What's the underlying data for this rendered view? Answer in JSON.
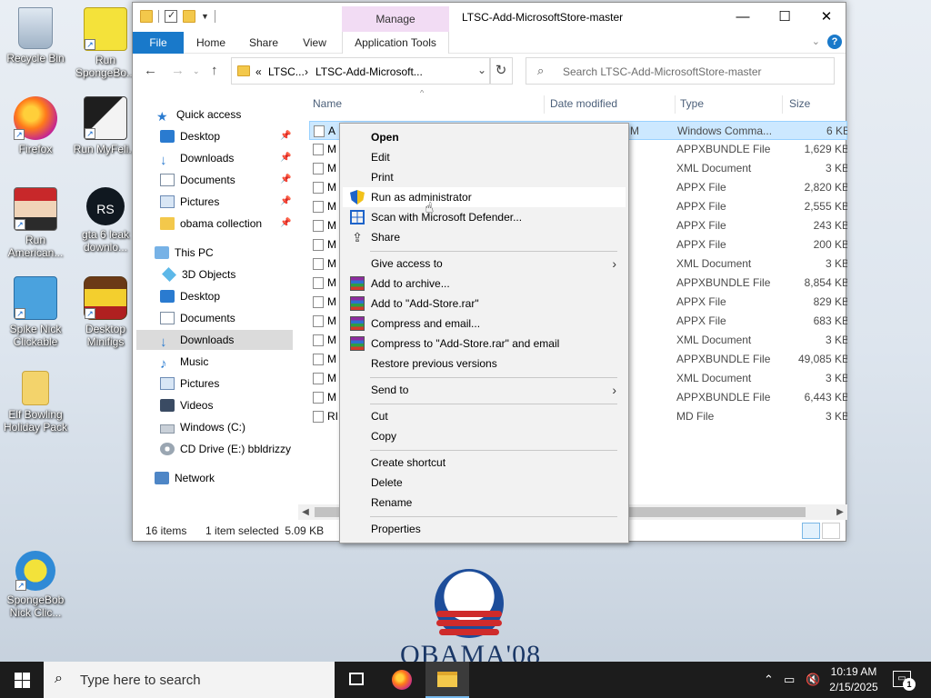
{
  "desktop": {
    "icons": [
      {
        "label": "Recycle Bin"
      },
      {
        "label": "Run SpongeBo..."
      },
      {
        "label": "Firefox"
      },
      {
        "label": "Run MyFeli..."
      },
      {
        "label": "Run American..."
      },
      {
        "label": "gta 6 leak downlo..."
      },
      {
        "label": "Spike Nick Clickable"
      },
      {
        "label": "Desktop Minifigs"
      },
      {
        "label": "Elf Bowling Holiday Pack"
      },
      {
        "label": "SpongeBob Nick Clic..."
      }
    ],
    "wallpaper_text": "OBAMA'08"
  },
  "window": {
    "title": "LTSC-Add-MicrosoftStore-master",
    "manage_header": "Manage",
    "controls": {
      "minimize": "—",
      "maximize": "☐",
      "close": "✕"
    },
    "ribbon_tabs": [
      "File",
      "Home",
      "Share",
      "View",
      "Application Tools"
    ],
    "help": "?",
    "address": {
      "crumbs": [
        "«",
        "LTSC...",
        "›",
        "LTSC-Add-Microsoft...",
        "⌄"
      ]
    },
    "search_placeholder": "Search LTSC-Add-MicrosoftStore-master",
    "nav": [
      {
        "label": "Quick access",
        "icon": "star-icon"
      },
      {
        "label": "Desktop",
        "icon": "desktop-icon",
        "pinned": true
      },
      {
        "label": "Downloads",
        "icon": "download-icon",
        "pinned": true
      },
      {
        "label": "Documents",
        "icon": "documents-icon",
        "pinned": true
      },
      {
        "label": "Pictures",
        "icon": "pictures-icon",
        "pinned": true
      },
      {
        "label": "obama collection",
        "icon": "folder-icon",
        "pinned": true
      },
      {
        "label": "This PC",
        "icon": "computer-icon"
      },
      {
        "label": "3D Objects",
        "icon": "cube-icon"
      },
      {
        "label": "Desktop",
        "icon": "desktop-icon"
      },
      {
        "label": "Documents",
        "icon": "documents-icon"
      },
      {
        "label": "Downloads",
        "icon": "download-icon",
        "selected": true
      },
      {
        "label": "Music",
        "icon": "music-icon"
      },
      {
        "label": "Pictures",
        "icon": "pictures-icon"
      },
      {
        "label": "Videos",
        "icon": "videos-icon"
      },
      {
        "label": "Windows (C:)",
        "icon": "drive-icon"
      },
      {
        "label": "CD Drive (E:) bbldrizzy",
        "icon": "cd-icon"
      },
      {
        "label": "Network",
        "icon": "network-icon"
      }
    ],
    "columns": {
      "name": "Name",
      "date": "Date modified",
      "type": "Type",
      "size": "Size"
    },
    "files": [
      {
        "name": "A",
        "date": "M",
        "type": "Windows Comma...",
        "size": "6 KB",
        "selected": true
      },
      {
        "name": "M",
        "type": "APPXBUNDLE File",
        "size": "1,629 KB"
      },
      {
        "name": "M",
        "type": "XML Document",
        "size": "3 KB"
      },
      {
        "name": "M",
        "type": "APPX File",
        "size": "2,820 KB"
      },
      {
        "name": "M",
        "type": "APPX File",
        "size": "2,555 KB"
      },
      {
        "name": "M",
        "type": "APPX File",
        "size": "243 KB"
      },
      {
        "name": "M",
        "type": "APPX File",
        "size": "200 KB"
      },
      {
        "name": "M",
        "type": "XML Document",
        "size": "3 KB"
      },
      {
        "name": "M",
        "type": "APPXBUNDLE File",
        "size": "8,854 KB"
      },
      {
        "name": "M",
        "type": "APPX File",
        "size": "829 KB"
      },
      {
        "name": "M",
        "type": "APPX File",
        "size": "683 KB"
      },
      {
        "name": "M",
        "type": "XML Document",
        "size": "3 KB"
      },
      {
        "name": "M",
        "type": "APPXBUNDLE File",
        "size": "49,085 KB"
      },
      {
        "name": "M",
        "type": "XML Document",
        "size": "3 KB"
      },
      {
        "name": "M",
        "type": "APPXBUNDLE File",
        "size": "6,443 KB"
      },
      {
        "name": "RI",
        "type": "MD File",
        "size": "3 KB"
      }
    ],
    "status": {
      "count": "16 items",
      "selection": "1 item selected  5.09 KB"
    }
  },
  "context_menu": {
    "items": [
      {
        "label": "Open",
        "bold": true
      },
      {
        "label": "Edit"
      },
      {
        "label": "Print"
      },
      {
        "label": "Run as administrator",
        "icon": "uac-shield-icon",
        "hover": true
      },
      {
        "label": "Scan with Microsoft Defender...",
        "icon": "defender-icon"
      },
      {
        "label": "Share",
        "icon": "share-icon"
      },
      {
        "label": "Give access to",
        "submenu": true
      },
      {
        "label": "Add to archive...",
        "icon": "winrar-icon"
      },
      {
        "label": "Add to \"Add-Store.rar\"",
        "icon": "winrar-icon"
      },
      {
        "label": "Compress and email...",
        "icon": "winrar-icon"
      },
      {
        "label": "Compress to \"Add-Store.rar\" and email",
        "icon": "winrar-icon"
      },
      {
        "label": "Restore previous versions"
      },
      {
        "label": "Send to",
        "submenu": true
      },
      {
        "label": "Cut"
      },
      {
        "label": "Copy"
      },
      {
        "label": "Create shortcut"
      },
      {
        "label": "Delete"
      },
      {
        "label": "Rename"
      },
      {
        "label": "Properties"
      }
    ]
  },
  "taskbar": {
    "search_placeholder": "Type here to search",
    "time": "10:19 AM",
    "date": "2/15/2025",
    "notifications": "1"
  },
  "colors": {
    "accent": "#1979ca",
    "selection": "#cce8ff",
    "manage": "#f2dcf4",
    "taskbar": "#1c1c1c"
  }
}
